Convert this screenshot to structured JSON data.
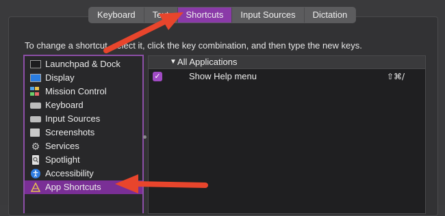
{
  "tabs": [
    {
      "label": "Keyboard",
      "active": false
    },
    {
      "label": "Text",
      "active": false
    },
    {
      "label": "Shortcuts",
      "active": true
    },
    {
      "label": "Input Sources",
      "active": false
    },
    {
      "label": "Dictation",
      "active": false
    }
  ],
  "instructions": "To change a shortcut, select it, click the key combination, and then type the new keys.",
  "sidebar": {
    "items": [
      {
        "label": "Launchpad & Dock",
        "icon": "launchpad-dock-icon"
      },
      {
        "label": "Display",
        "icon": "display-icon"
      },
      {
        "label": "Mission Control",
        "icon": "mission-control-icon"
      },
      {
        "label": "Keyboard",
        "icon": "keyboard-icon"
      },
      {
        "label": "Input Sources",
        "icon": "input-sources-icon"
      },
      {
        "label": "Screenshots",
        "icon": "screenshots-icon"
      },
      {
        "label": "Services",
        "icon": "gear-icon"
      },
      {
        "label": "Spotlight",
        "icon": "spotlight-icon"
      },
      {
        "label": "Accessibility",
        "icon": "accessibility-icon"
      },
      {
        "label": "App Shortcuts",
        "icon": "app-shortcuts-icon",
        "selected": true
      }
    ]
  },
  "table": {
    "group_label": "All Applications",
    "rows": [
      {
        "checked": true,
        "command": "Show Help menu",
        "shortcut": "⇧⌘/"
      }
    ]
  },
  "colors": {
    "accent": "#8a3aa8",
    "selection": "#7a2f96",
    "annotation_arrow": "#e8452c"
  }
}
